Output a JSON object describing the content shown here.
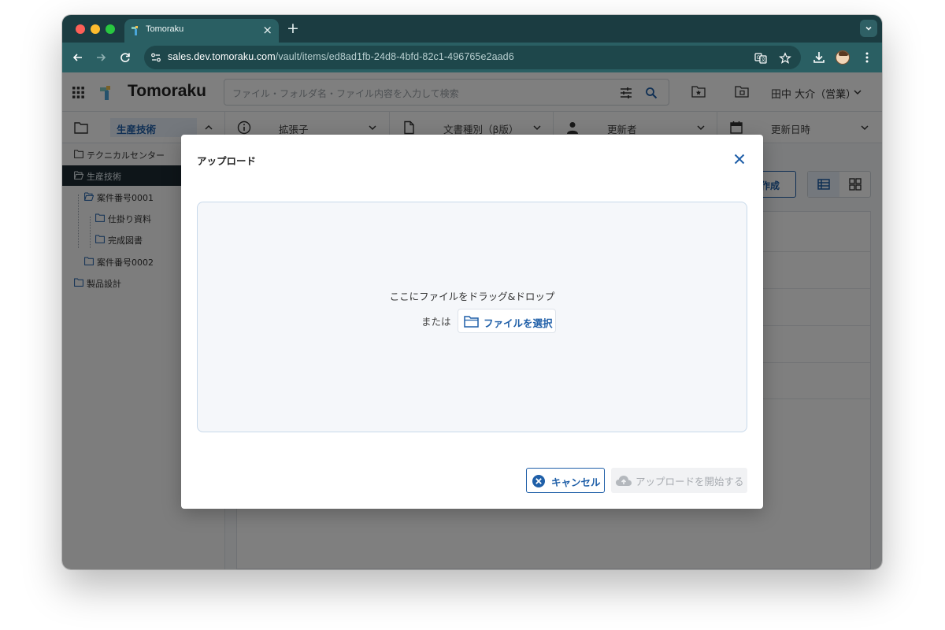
{
  "browser": {
    "tab_title": "Tomoraku",
    "url_host": "sales.dev.tomoraku.com",
    "url_path": "/vault/items/ed8ad1fb-24d8-4bfd-82c1-496765e2aad6",
    "colors": {
      "tabbar": "#1b3c41",
      "toolbar": "#2a5f63"
    }
  },
  "app": {
    "brand": "Tomoraku",
    "search_placeholder": "ファイル・フォルダ名・ファイル内容を入力して検索",
    "user_name": "田中 大介（営業）",
    "filters": [
      {
        "label": "拡張子",
        "icon": "info-icon"
      },
      {
        "label": "文書種別（β版）",
        "icon": "document-icon"
      },
      {
        "label": "更新者",
        "icon": "person-icon"
      },
      {
        "label": "更新日時",
        "icon": "calendar-icon"
      }
    ],
    "selected_folder": "生産技術",
    "create_label": "作成",
    "tree": [
      {
        "label": "テクニカルセンター",
        "level": 0
      },
      {
        "label": "生産技術",
        "level": 0,
        "active": true
      },
      {
        "label": "案件番号0001",
        "level": 1
      },
      {
        "label": "仕掛り資料",
        "level": 2
      },
      {
        "label": "完成図書",
        "level": 2
      },
      {
        "label": "案件番号0002",
        "level": 1
      },
      {
        "label": "製品設計",
        "level": 0
      }
    ]
  },
  "modal": {
    "title": "アップロード",
    "drop_text": "ここにファイルをドラッグ&ドロップ",
    "or_text": "または",
    "select_label": "ファイルを選択",
    "cancel_label": "キャンセル",
    "upload_label": "アップロードを開始する",
    "upload_enabled": false,
    "accent_color": "#1f5fa8"
  }
}
